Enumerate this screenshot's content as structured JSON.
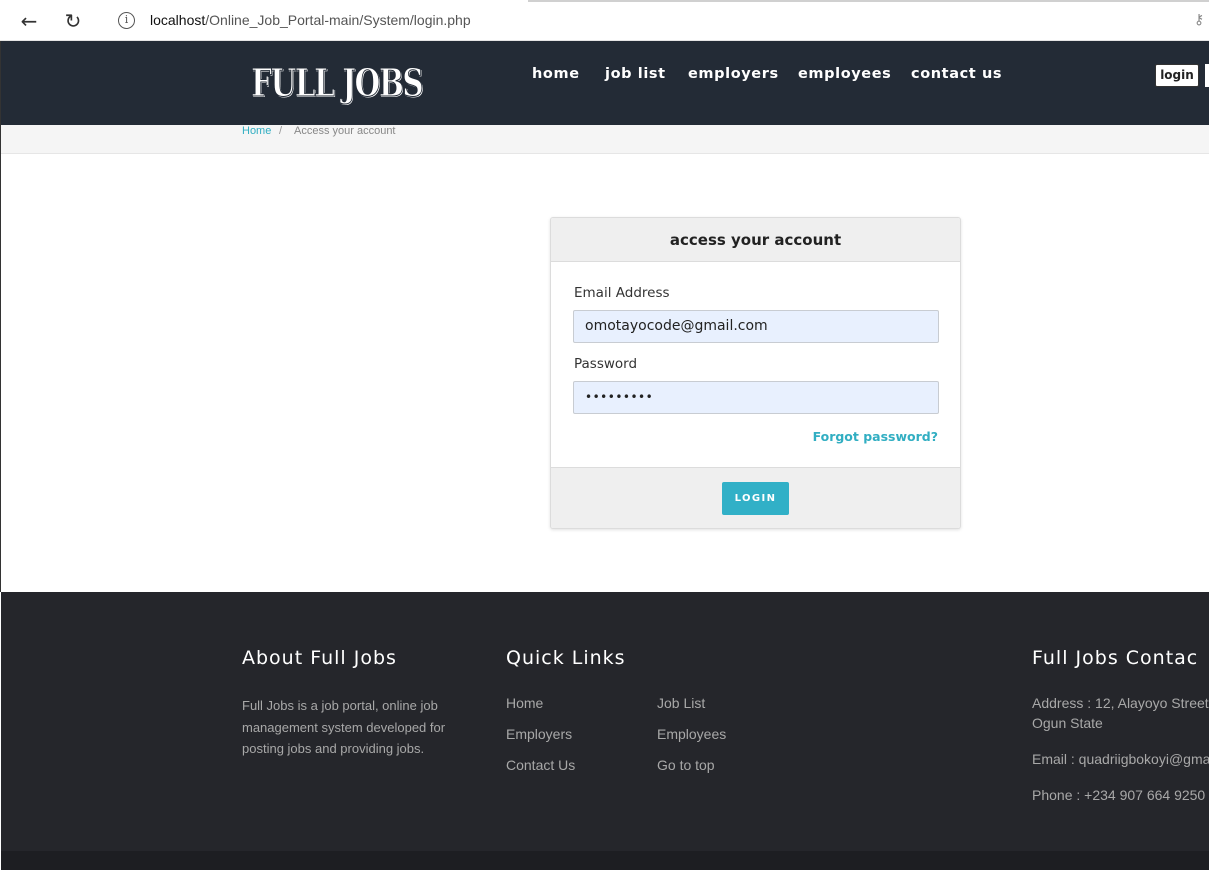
{
  "browser": {
    "url_host": "localhost",
    "url_path": "/Online_Job_Portal-main/System/login.php",
    "back_icon": "←",
    "reload_icon": "↻",
    "info_icon": "i",
    "key_icon": "⚷"
  },
  "header": {
    "logo": "FULL JOBS",
    "nav": [
      "home",
      "job list",
      "employers",
      "employees",
      "contact us"
    ],
    "login_label": "login"
  },
  "breadcrumb": {
    "home": "Home",
    "separator": "/",
    "current": "Access your account"
  },
  "login_card": {
    "title": "access your account",
    "email_label": "Email Address",
    "email_value": "omotayocode@gmail.com",
    "password_label": "Password",
    "password_value": "•••••••••",
    "forgot_label": "Forgot password?",
    "submit_label": "LOGIN"
  },
  "footer": {
    "about_title": "About Full Jobs",
    "about_text": "Full Jobs is a job portal, online job management system developed for posting jobs and providing jobs.",
    "links_title": "Quick Links",
    "links": [
      "Home",
      "Employers",
      "Contact Us",
      "Job List",
      "Employees",
      "Go to top"
    ],
    "contact_title": "Full Jobs Contac",
    "address_line1": "Address : 12, Alayoyo Street,",
    "address_line2": "Ogun State",
    "email_line": "Email : quadriigbokoyi@gma",
    "phone_line": "Phone : +234 907 664 9250"
  },
  "colors": {
    "header_bg": "#232b36",
    "accent": "#31aec2",
    "footer_bg": "#25262b",
    "input_bg": "#e8f0fe"
  }
}
